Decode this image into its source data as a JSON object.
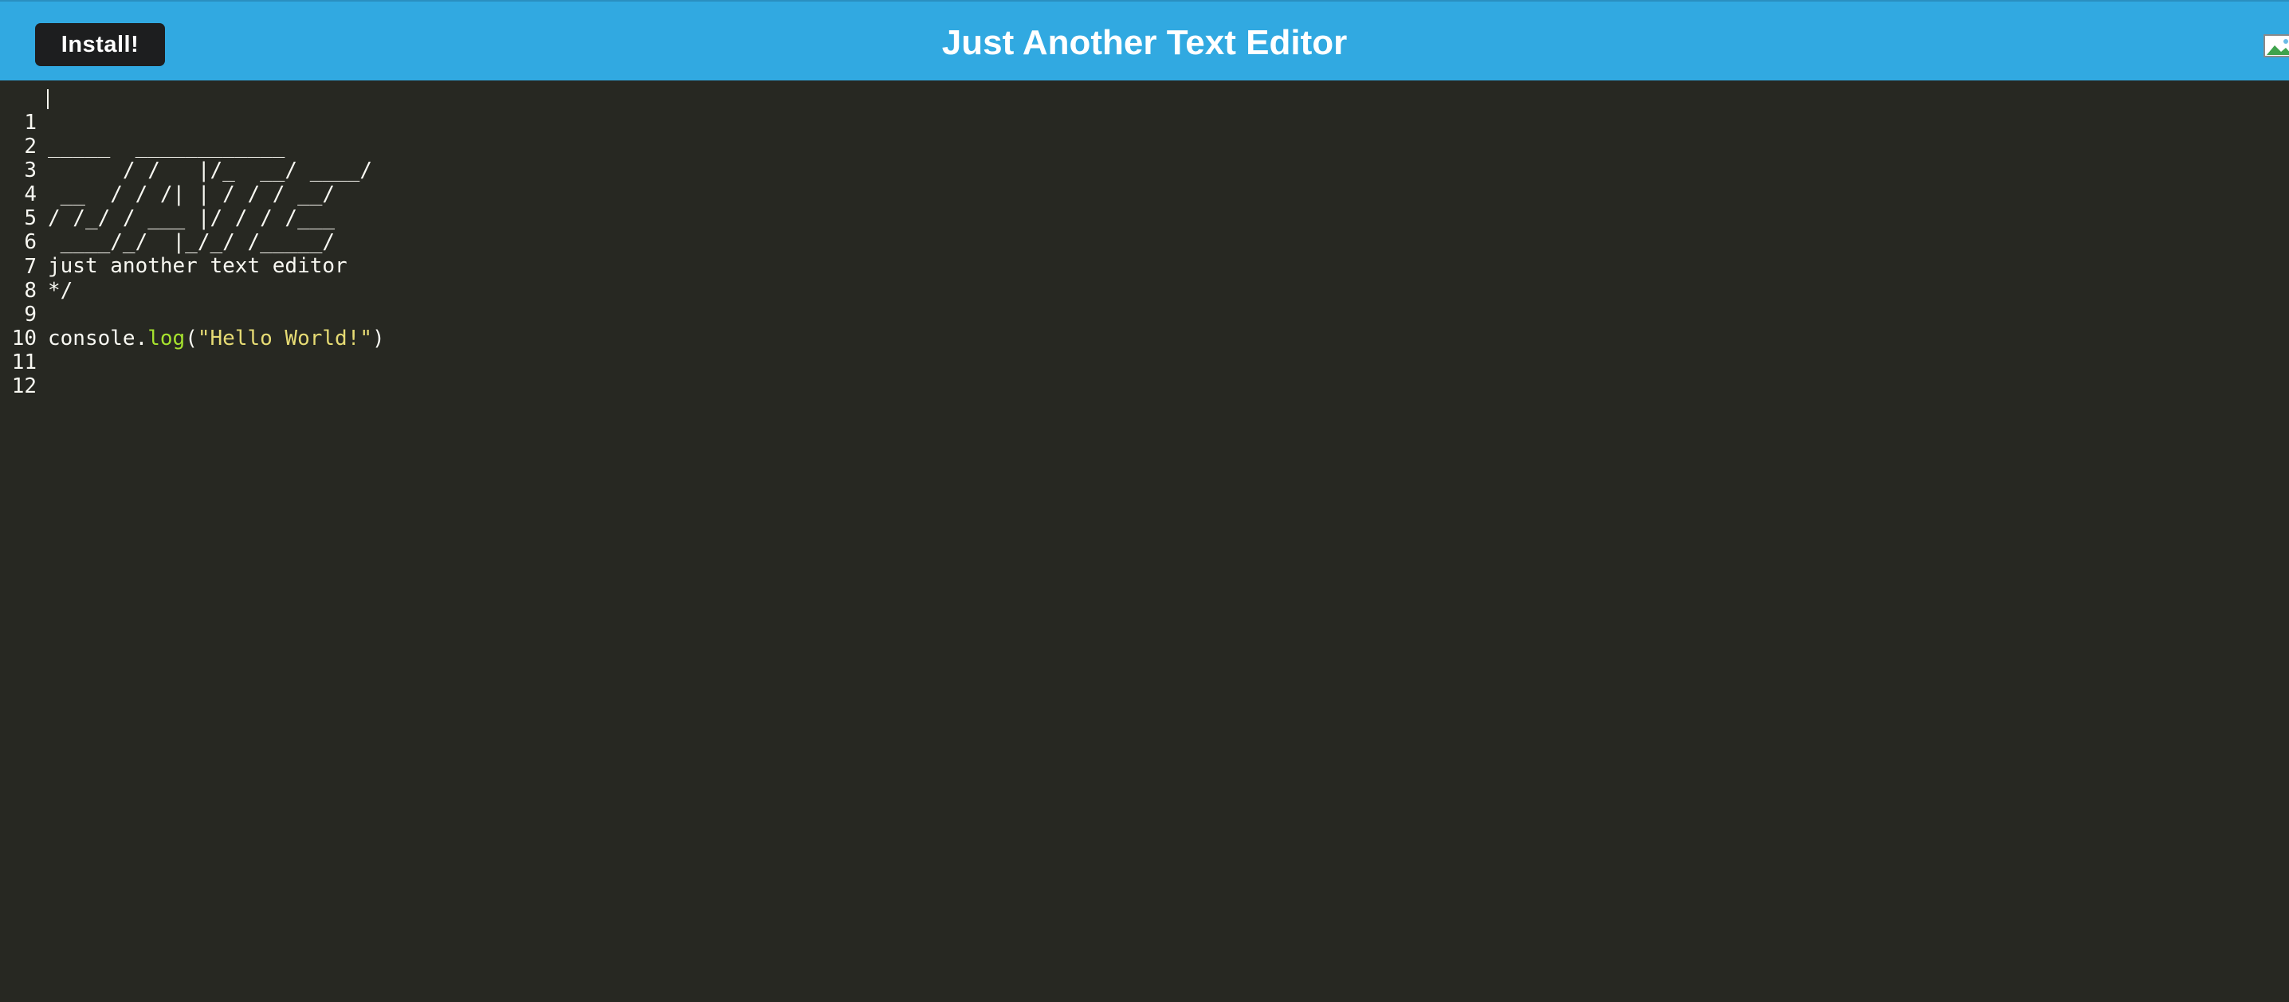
{
  "header": {
    "install_label": "Install!",
    "title": "Just Another Text Editor",
    "logo_icon": "app-logo-broken-image-icon"
  },
  "editor": {
    "lines": [
      {
        "n": "1",
        "text": "_____  ____________"
      },
      {
        "n": "2",
        "text": "      / /   |/_  __/ ____/"
      },
      {
        "n": "3",
        "text": " __  / / /| | / / / __/"
      },
      {
        "n": "4",
        "text": "/ /_/ / ___ |/ / / /___"
      },
      {
        "n": "5",
        "text": " ____/_/  |_/_/ /_____/"
      },
      {
        "n": "6",
        "text": "just another text editor"
      },
      {
        "n": "7",
        "text": "*/"
      },
      {
        "n": "8",
        "text": ""
      },
      {
        "n": "9",
        "tokens": [
          "console.",
          "log",
          "(",
          "\"Hello World!\"",
          ")"
        ]
      },
      {
        "n": "10",
        "text": ""
      },
      {
        "n": "11",
        "text": ""
      },
      {
        "n": "12",
        "text": ""
      }
    ]
  },
  "colors": {
    "navbar": "#31a9e1",
    "editor_bg": "#272822",
    "install_bg": "#1d1e1f",
    "text": "#f8f8f2",
    "property": "#a6e22e",
    "string": "#e6db74"
  }
}
